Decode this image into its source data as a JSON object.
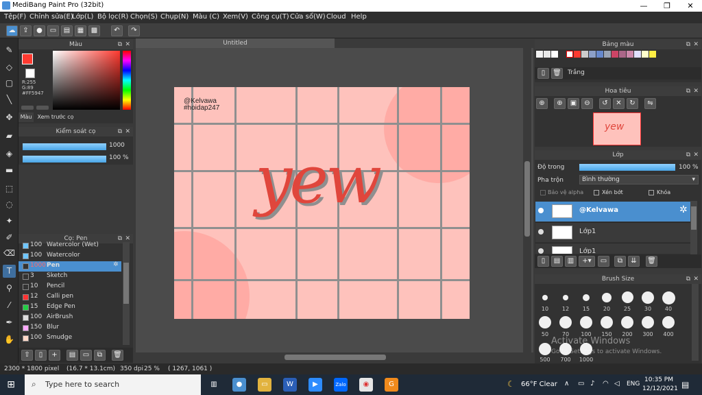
{
  "window": {
    "title": "MediBang Paint Pro (32bit)",
    "minimize": "—",
    "maximize": "❐",
    "close": "✕"
  },
  "menu": [
    "Tệp(F)",
    "Chỉnh sửa(E)",
    "Lớp(L)",
    "Bộ lọc(R)",
    "Chọn(S)",
    "Chụp(N)",
    "Màu (C)",
    "Xem(V)",
    "Công cụ(T)",
    "Cửa sổ(W)",
    "Cloud",
    "Help"
  ],
  "color_panel": {
    "title": "Màu",
    "r": "R:255",
    "g": "G:89",
    "b": "B:71",
    "hex": "#FF5947",
    "tab_color": "Màu",
    "tab_preview": "Xem trước cọ",
    "primary": "#ff3a30",
    "secondary": "#ffffff"
  },
  "brush_control": {
    "title": "Kiểm soát cọ",
    "size": "1000",
    "opacity": "100 %"
  },
  "brush_panel": {
    "title": "Cọ: Pen",
    "items": [
      {
        "size": "100",
        "name": "Watercolor (Wet)",
        "color": "#6fc6ff"
      },
      {
        "size": "100",
        "name": "Watercolor",
        "color": "#6fc6ff"
      },
      {
        "size": "1000",
        "name": "Pen",
        "color": "#333333"
      },
      {
        "size": "3",
        "name": "Sketch",
        "color": "#333333"
      },
      {
        "size": "10",
        "name": "Pencil",
        "color": "#333333"
      },
      {
        "size": "12",
        "name": "Calli pen",
        "color": "#ff3333"
      },
      {
        "size": "15",
        "name": "Edge Pen",
        "color": "#22cc44"
      },
      {
        "size": "100",
        "name": "AirBrush",
        "color": "#dddddd"
      },
      {
        "size": "150",
        "name": "Blur",
        "color": "#ffaaff"
      },
      {
        "size": "100",
        "name": "Smudge",
        "color": "#ffd8c8"
      }
    ]
  },
  "document": {
    "tab": "Untitled",
    "watermark": "@Kelvawa",
    "hashtag": "#hoidap247",
    "lettering": "yew"
  },
  "palette_panel": {
    "title": "Bảng màu",
    "selected_name": "Trắng",
    "swatches": [
      "#f2f2f2",
      "#e8e8e8",
      "#ffffff",
      "#333333",
      "#ffffff",
      "#ff3a30",
      "#cccccc",
      "#8ca0c8",
      "#6688cc",
      "#9aa4b4",
      "#cc4466",
      "#aa6688",
      "#cc88aa",
      "#e0e0ff",
      "#ffffcc",
      "#ffee44"
    ]
  },
  "navigator_panel": {
    "title": "Hoa tiêu"
  },
  "layer_panel": {
    "title": "Lớp",
    "opacity_label": "Độ trong",
    "opacity_value": "100 %",
    "blend_label": "Pha trộn",
    "blend_value": "Bình thường",
    "protect_alpha": "Bảo vệ alpha",
    "clipping": "Xén bớt",
    "lock": "Khóa",
    "layers": [
      {
        "name": "@Kelvawa",
        "selected": true
      },
      {
        "name": "Lớp1",
        "selected": false
      },
      {
        "name": "Lớp1",
        "selected": false
      }
    ]
  },
  "brush_size_panel": {
    "title": "Brush Size",
    "sizes": [
      "10",
      "12",
      "15",
      "20",
      "25",
      "30",
      "40",
      "50",
      "70",
      "100",
      "150",
      "200",
      "300",
      "400",
      "500",
      "700",
      "1000"
    ]
  },
  "watermark_os": {
    "line1": "Activate Windows",
    "line2": "Go to Settings to activate Windows."
  },
  "status": {
    "dimensions": "2300 * 1800 pixel",
    "size_cm": "(16.7 * 13.1cm)",
    "dpi": "350 dpi",
    "zoom": "25 %",
    "coords": "( 1267, 1061 )"
  },
  "taskbar": {
    "search_placeholder": "Type here to search",
    "weather": "66°F  Clear",
    "lang": "ENG",
    "time": "10:35 PM",
    "date": "12/12/2021"
  }
}
